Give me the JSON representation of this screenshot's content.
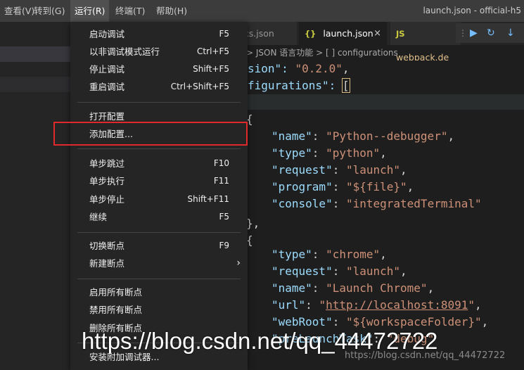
{
  "menubar": {
    "items": [
      "查看(V)",
      "转到(G)",
      "运行(R)",
      "终端(T)",
      "帮助(H)"
    ],
    "window_title": "launch.json - official-h5"
  },
  "tabs": [
    {
      "label": "tasks.json",
      "visible_label": "sks.json",
      "icon": ""
    },
    {
      "label": "launch.json",
      "icon": "{}",
      "close": "×"
    },
    {
      "label": "webpack.de",
      "icon": "JS"
    }
  ],
  "breadcrumb": "> JSON 语言功能 > [ ] configurations",
  "debug_toolbar": [
    "pause-resume-icon",
    "restart-icon",
    "step-into-icon"
  ],
  "run_menu": {
    "groups": [
      [
        {
          "label": "启动调试",
          "shortcut": "F5"
        },
        {
          "label": "以非调试模式运行",
          "shortcut": "Ctrl+F5"
        },
        {
          "label": "停止调试",
          "shortcut": "Shift+F5"
        },
        {
          "label": "重启调试",
          "shortcut": "Ctrl+Shift+F5"
        }
      ],
      [
        {
          "label": "打开配置",
          "shortcut": ""
        },
        {
          "label": "添加配置...",
          "shortcut": ""
        }
      ],
      [
        {
          "label": "单步跳过",
          "shortcut": "F10"
        },
        {
          "label": "单步执行",
          "shortcut": "F11"
        },
        {
          "label": "单步停止",
          "shortcut": "Shift+F11"
        },
        {
          "label": "继续",
          "shortcut": "F5"
        }
      ],
      [
        {
          "label": "切换断点",
          "shortcut": "F9"
        },
        {
          "label": "新建断点",
          "shortcut": "",
          "submenu": true
        }
      ],
      [
        {
          "label": "启用所有断点",
          "shortcut": ""
        },
        {
          "label": "禁用所有断点",
          "shortcut": ""
        },
        {
          "label": "删除所有断点",
          "shortcut": ""
        }
      ],
      [
        {
          "label": "安装附加调试器...",
          "shortcut": ""
        }
      ]
    ],
    "highlighted": "添加配置..."
  },
  "code": {
    "l1": [
      "sion\": ",
      "\"0.2.0\"",
      ","
    ],
    "l2": [
      "figurations\": ",
      "["
    ],
    "l3": [
      "\"name\"",
      ": ",
      "\"Python--debugger\"",
      ","
    ],
    "l4": [
      "\"type\"",
      ": ",
      "\"python\"",
      ","
    ],
    "l5": [
      "\"request\"",
      ": ",
      "\"launch\"",
      ","
    ],
    "l6": [
      "\"program\"",
      ": ",
      "\"${file}\"",
      ","
    ],
    "l7": [
      "\"console\"",
      ": ",
      "\"integratedTerminal\""
    ],
    "l8": [
      "\"type\"",
      ": ",
      "\"chrome\"",
      ","
    ],
    "l9": [
      "\"request\"",
      ": ",
      "\"launch\"",
      ","
    ],
    "l10": [
      "\"name\"",
      ": ",
      "\"Launch Chrome\"",
      ","
    ],
    "l11": [
      "\"url\"",
      ": ",
      "\"",
      "http://localhost:8091",
      "\"",
      ","
    ],
    "l12": [
      "\"webRoot\"",
      ": ",
      "\"${workspaceFolder}\"",
      ","
    ],
    "l13": [
      "\"preLaunchTask\"",
      ": ",
      "\"debug\""
    ],
    "brace_close": "},",
    "brace_open": "{"
  },
  "watermark": "https://blog.csdn.net/qq_44472722",
  "watermark_small": "https://blog.csdn.net/qq_44472722"
}
